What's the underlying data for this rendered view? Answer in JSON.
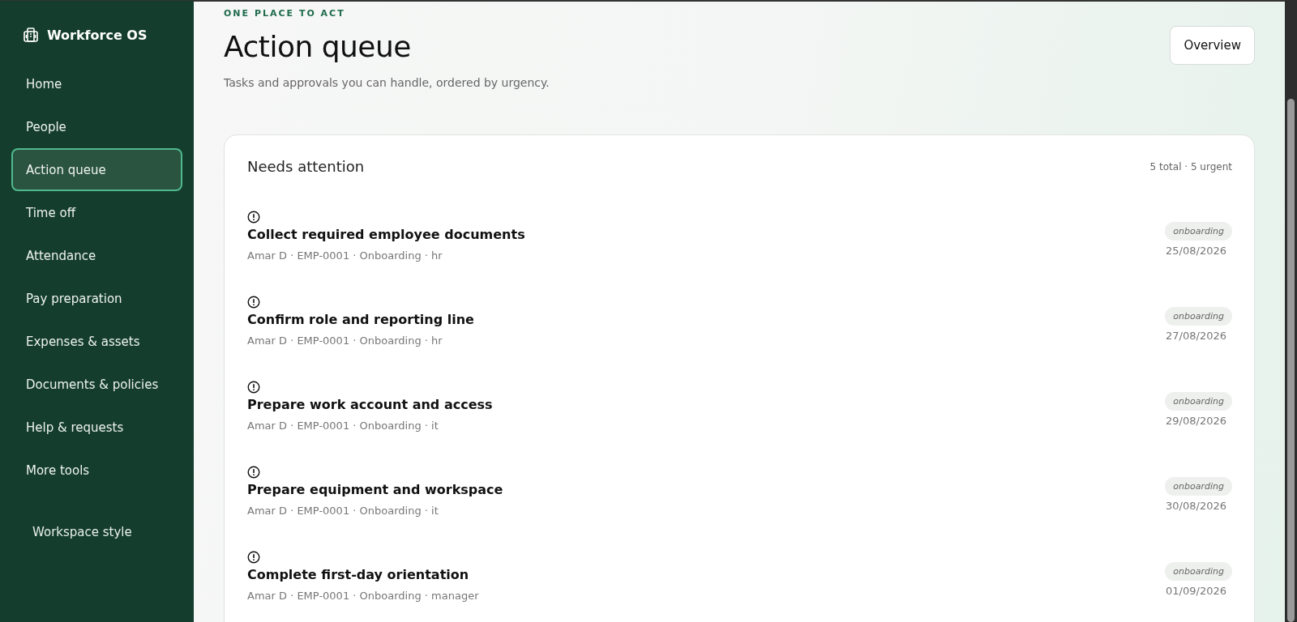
{
  "sidebar": {
    "brand": "Workforce OS",
    "items": [
      {
        "label": "Home",
        "selected": false
      },
      {
        "label": "People",
        "selected": false
      },
      {
        "label": "Action queue",
        "selected": true
      },
      {
        "label": "Time off",
        "selected": false
      },
      {
        "label": "Attendance",
        "selected": false
      },
      {
        "label": "Pay preparation",
        "selected": false
      },
      {
        "label": "Expenses & assets",
        "selected": false
      },
      {
        "label": "Documents & policies",
        "selected": false
      },
      {
        "label": "Help & requests",
        "selected": false
      },
      {
        "label": "More tools",
        "selected": false
      }
    ],
    "footer_link": "Workspace style"
  },
  "header": {
    "eyebrow": "ONE PLACE TO ACT",
    "title": "Action queue",
    "subtitle": "Tasks and approvals you can handle, ordered by urgency.",
    "button": "Overview"
  },
  "card": {
    "title": "Needs attention",
    "summary": "5 total · 5 urgent",
    "items": [
      {
        "urgent": true,
        "title": "Collect required employee documents",
        "meta": "Amar D · EMP-0001 · Onboarding · hr",
        "tag": "onboarding",
        "date": "25/08/2026"
      },
      {
        "urgent": true,
        "title": "Confirm role and reporting line",
        "meta": "Amar D · EMP-0001 · Onboarding · hr",
        "tag": "onboarding",
        "date": "27/08/2026"
      },
      {
        "urgent": true,
        "title": "Prepare work account and access",
        "meta": "Amar D · EMP-0001 · Onboarding · it",
        "tag": "onboarding",
        "date": "29/08/2026"
      },
      {
        "urgent": true,
        "title": "Prepare equipment and workspace",
        "meta": "Amar D · EMP-0001 · Onboarding · it",
        "tag": "onboarding",
        "date": "30/08/2026"
      },
      {
        "urgent": true,
        "title": "Complete first-day orientation",
        "meta": "Amar D · EMP-0001 · Onboarding · manager",
        "tag": "onboarding",
        "date": "01/09/2026"
      }
    ]
  }
}
